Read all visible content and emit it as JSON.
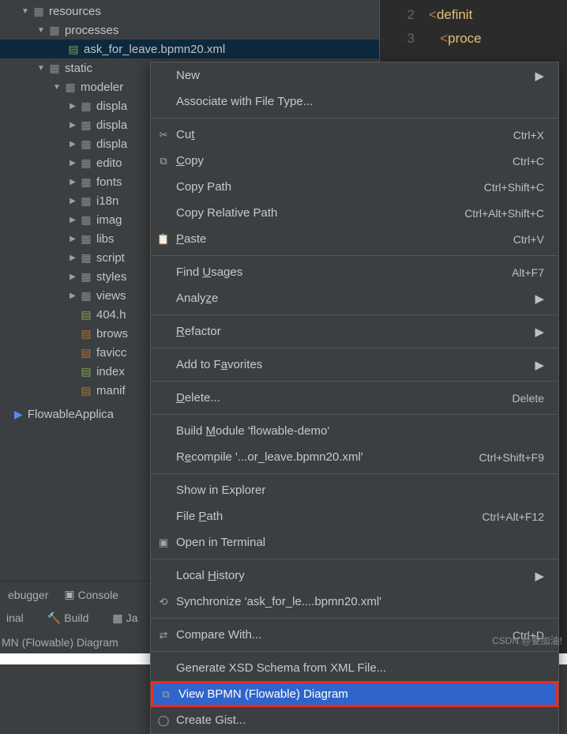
{
  "editor": {
    "lines": [
      {
        "num": "2",
        "bracket": "<",
        "tag": "definit"
      },
      {
        "num": "3",
        "bracket": "<",
        "tag": "proce"
      }
    ]
  },
  "tree": {
    "resources": "resources",
    "processes": "processes",
    "selected_file": "ask_for_leave.bpmn20.xml",
    "static": "static",
    "modeler": "modeler",
    "display0": "displa",
    "display1": "displa",
    "display2": "displa",
    "editor": "edito",
    "fonts": "fonts",
    "i18n": "i18n",
    "images": "imag",
    "libs": "libs",
    "scripts": "script",
    "stylesheets": "styles",
    "views": "views",
    "f404": "404.h",
    "browserconfig": "brows",
    "favicon": "favicc",
    "index": "index",
    "manifest": "manif",
    "app": "FlowableApplica"
  },
  "bottomTabs": {
    "debugger": "ebugger",
    "console": "Console"
  },
  "statusBar": {
    "terminal": "inal",
    "build": "Build",
    "java": "Ja"
  },
  "statusBar2": "MN (Flowable) Diagram",
  "ctx": {
    "new": "New",
    "assoc": "Associate with File Type...",
    "cut": {
      "pre": "Cu",
      "u": "t"
    },
    "cut_sc": "Ctrl+X",
    "copy": {
      "u": "C",
      "post": "opy"
    },
    "copy_sc": "Ctrl+C",
    "copy_path": "Copy Path",
    "copy_path_sc": "Ctrl+Shift+C",
    "copy_rel": "Copy Relative Path",
    "copy_rel_sc": "Ctrl+Alt+Shift+C",
    "paste": {
      "u": "P",
      "post": "aste"
    },
    "paste_sc": "Ctrl+V",
    "find_usages": {
      "pre": "Find ",
      "u": "U",
      "post": "sages"
    },
    "find_sc": "Alt+F7",
    "analyze": {
      "pre": "Analy",
      "u": "z",
      "post": "e"
    },
    "refactor": {
      "u": "R",
      "post": "efactor"
    },
    "add_fav": {
      "pre": "Add to F",
      "u": "a",
      "post": "vorites"
    },
    "delete": {
      "u": "D",
      "post": "elete..."
    },
    "delete_sc": "Delete",
    "build_module": {
      "pre": "Build ",
      "u": "M",
      "post": "odule 'flowable-demo'"
    },
    "recompile": {
      "pre": "R",
      "u": "e",
      "post": "compile '...or_leave.bpmn20.xml'"
    },
    "recompile_sc": "Ctrl+Shift+F9",
    "show_explorer": "Show in Explorer",
    "file_path": {
      "pre": "File ",
      "u": "P",
      "post": "ath"
    },
    "file_path_sc": "Ctrl+Alt+F12",
    "open_term": "Open in Terminal",
    "local_history": {
      "pre": "Local ",
      "u": "H",
      "post": "istory"
    },
    "sync": "Synchronize 'ask_for_le....bpmn20.xml'",
    "compare": "Compare With...",
    "compare_sc": "Ctrl+D",
    "gen_xsd": "Generate XSD Schema from XML File...",
    "view_bpmn": "View BPMN (Flowable) Diagram",
    "create_gist": "Create Gist..."
  },
  "watermark": "CSDN @要加油!"
}
